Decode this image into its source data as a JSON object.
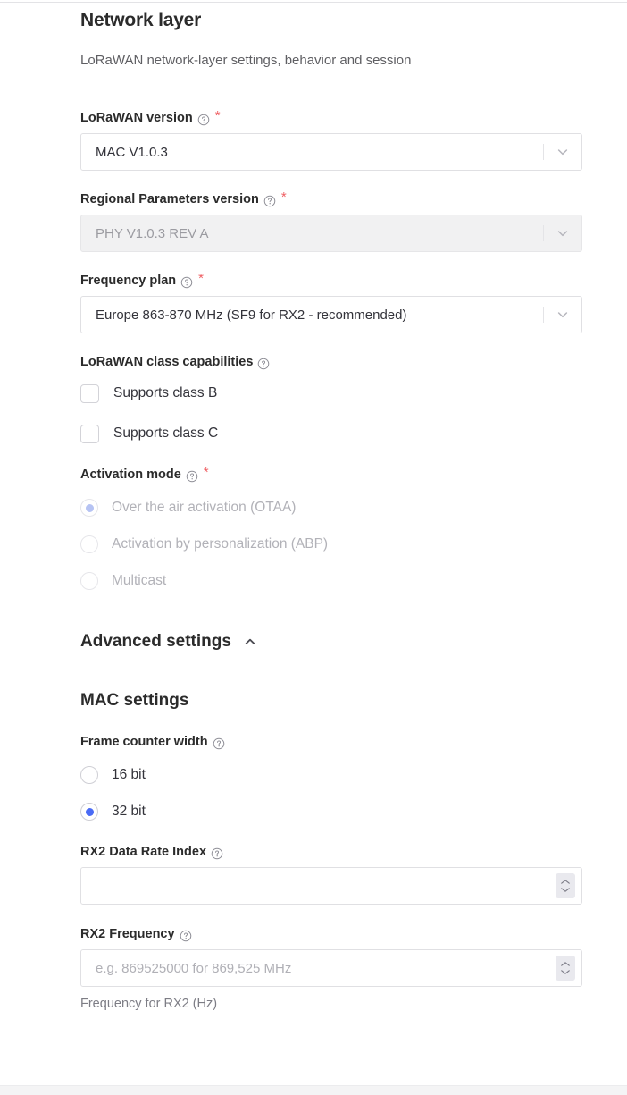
{
  "section": {
    "title": "Network layer",
    "description": "LoRaWAN network-layer settings, behavior and session"
  },
  "icons": {
    "help": "help-circle-icon",
    "chevron_down": "chevron-down-icon",
    "chevron_up": "chevron-up-icon",
    "stepper_up": "stepper-up-icon",
    "stepper_down": "stepper-down-icon"
  },
  "required_marker": "*",
  "colors": {
    "accent": "#4a6bf5",
    "accent_muted": "#b6c3f3",
    "required": "#ef5f63",
    "border": "#e0e0e3",
    "disabled_bg": "#f1f1f2",
    "disabled_text": "#9b9ba1",
    "placeholder": "#b0b0b6",
    "heading": "#2b2b2b"
  },
  "fields": {
    "lorawan_version": {
      "label": "LoRaWAN version",
      "value": "MAC V1.0.3",
      "required": true,
      "disabled": false
    },
    "regional_parameters_version": {
      "label": "Regional Parameters version",
      "value": "PHY V1.0.3 REV A",
      "required": true,
      "disabled": true
    },
    "frequency_plan": {
      "label": "Frequency plan",
      "value": "Europe 863-870 MHz (SF9 for RX2 - recommended)",
      "required": true,
      "disabled": false
    },
    "class_capabilities": {
      "label": "LoRaWAN class capabilities",
      "options": [
        {
          "label": "Supports class B",
          "checked": false
        },
        {
          "label": "Supports class C",
          "checked": false
        }
      ]
    },
    "activation_mode": {
      "label": "Activation mode",
      "required": true,
      "disabled": true,
      "options": [
        {
          "label": "Over the air activation (OTAA)",
          "selected": true
        },
        {
          "label": "Activation by personalization (ABP)",
          "selected": false
        },
        {
          "label": "Multicast",
          "selected": false
        }
      ]
    },
    "frame_counter_width": {
      "label": "Frame counter width",
      "options": [
        {
          "label": "16 bit",
          "selected": false
        },
        {
          "label": "32 bit",
          "selected": true
        }
      ]
    },
    "rx2_data_rate_index": {
      "label": "RX2 Data Rate Index",
      "value": "",
      "placeholder": ""
    },
    "rx2_frequency": {
      "label": "RX2 Frequency",
      "value": "",
      "placeholder": "e.g. 869525000 for 869,525 MHz",
      "help": "Frequency for RX2 (Hz)"
    }
  },
  "advanced": {
    "title": "Advanced settings",
    "expanded": true,
    "mac_settings_title": "MAC settings"
  }
}
